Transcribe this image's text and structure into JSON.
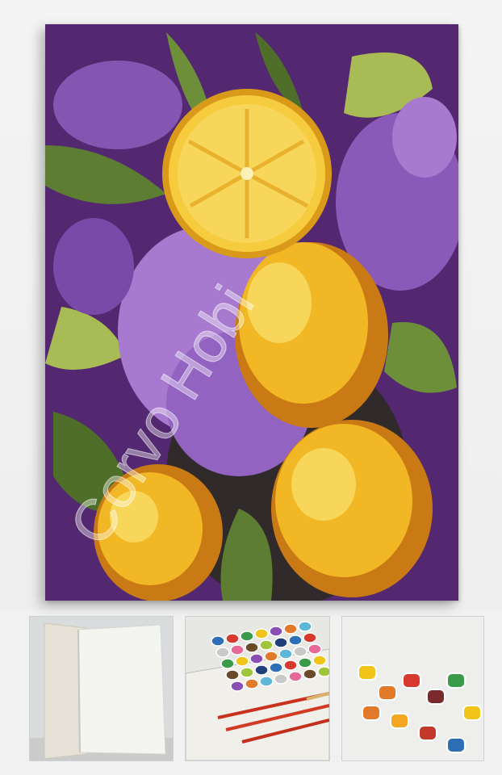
{
  "watermark": {
    "text": "Corvo Hobi"
  },
  "artwork": {
    "subject": "lemons-and-lilac-painting",
    "colors": {
      "background": "#5b2c7a",
      "lilac": "#a77ad0",
      "lilac_dark": "#7a4aa8",
      "lemon": "#f2b724",
      "lemon_light": "#f8d65a",
      "lemon_shadow": "#c97a14",
      "leaf": "#6e8f3a",
      "leaf_light": "#a9bb55"
    }
  },
  "thumbnails": [
    {
      "icon": "blank-canvas-icon"
    },
    {
      "icon": "paint-pots-and-brushes-icon"
    },
    {
      "icon": "open-paint-pots-icon"
    }
  ]
}
